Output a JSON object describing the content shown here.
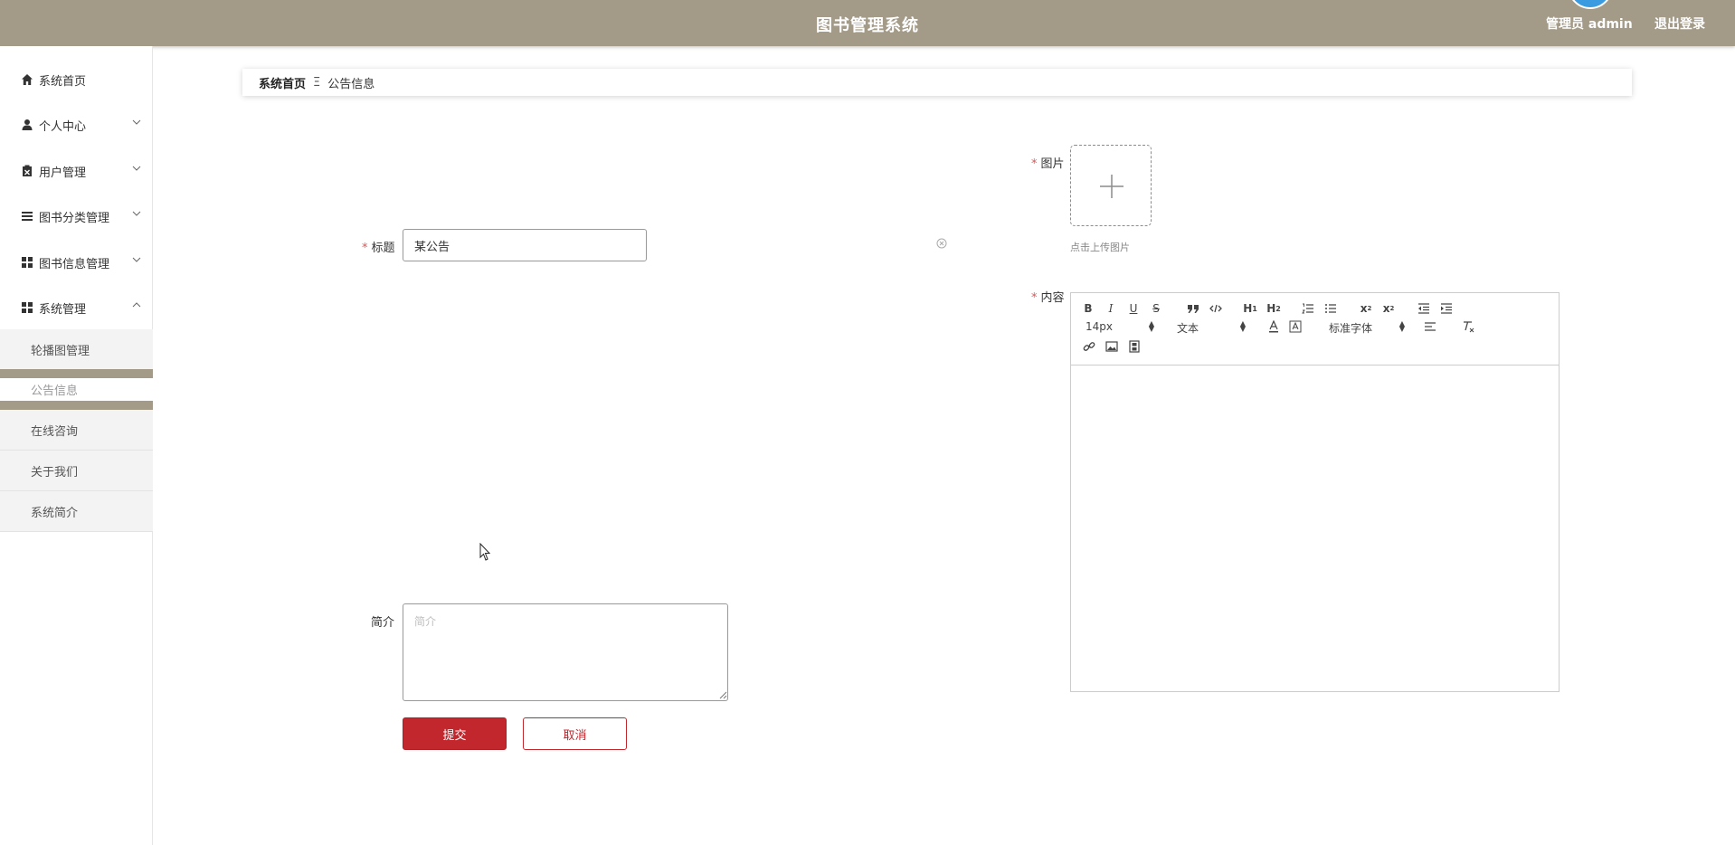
{
  "header": {
    "title": "图书管理系统",
    "user": "管理员 admin",
    "logout": "退出登录",
    "color": "#a39a88"
  },
  "sidebar": {
    "items": [
      {
        "label": "系统首页",
        "icon": "home-icon"
      },
      {
        "label": "个人中心",
        "icon": "person-icon"
      },
      {
        "label": "用户管理",
        "icon": "clipboard-x-icon"
      },
      {
        "label": "图书分类管理",
        "icon": "list-icon"
      },
      {
        "label": "图书信息管理",
        "icon": "grid-icon"
      },
      {
        "label": "系统管理",
        "icon": "grid-icon"
      }
    ],
    "submenu": [
      "轮播图管理",
      "公告信息",
      "在线咨询",
      "关于我们",
      "系统简介"
    ]
  },
  "breadcrumb": {
    "home": "系统首页",
    "separator": "Ξ",
    "current": "公告信息"
  },
  "form": {
    "title_label": "标题",
    "title_value": "某公告",
    "summary_label": "简介",
    "summary_placeholder": "简介",
    "image_label": "图片",
    "upload_tip": "点击上传图片",
    "content_label": "内容",
    "submit": "提交",
    "cancel": "取消",
    "accent": "#c1272d"
  },
  "editor": {
    "font_size": "14px",
    "text_type": "文本",
    "font_family": "标准字体"
  }
}
